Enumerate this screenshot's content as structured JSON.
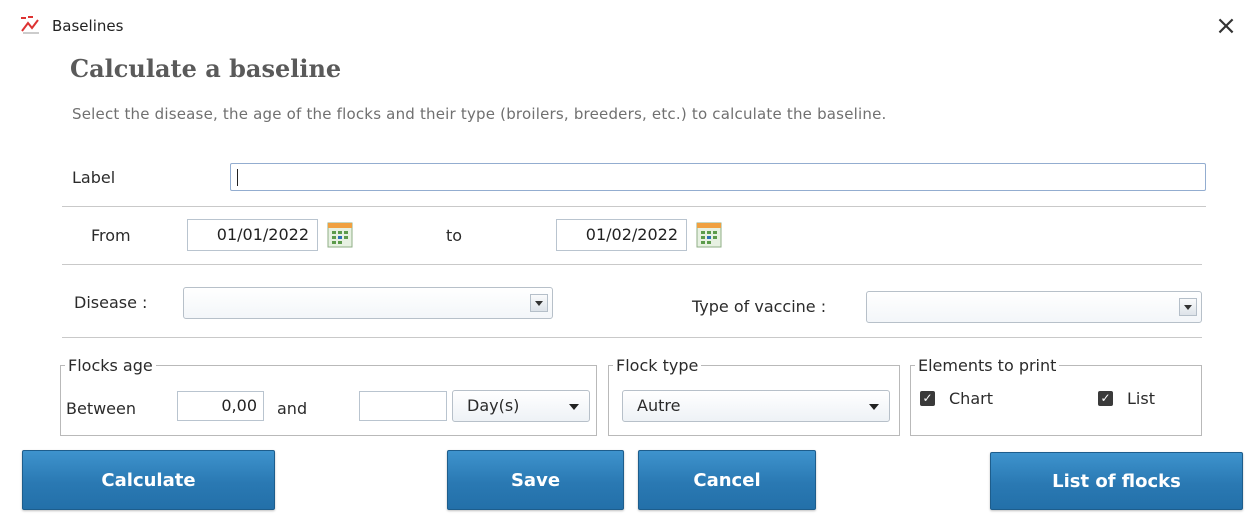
{
  "window": {
    "title": "Baselines",
    "close_glyph": "×",
    "icon": "baselines-app-icon"
  },
  "header": {
    "title": "Calculate a baseline",
    "description": "Select the disease, the age of the flocks and their type (broilers, breeders, etc.) to calculate the baseline."
  },
  "label_field": {
    "label": "Label",
    "value": ""
  },
  "date_range": {
    "from_label": "From",
    "from_value": "01/01/2022",
    "to_label": "to",
    "to_value": "01/02/2022",
    "icon": "calendar-icon"
  },
  "disease": {
    "label": "Disease :",
    "value": ""
  },
  "vaccine": {
    "label": "Type of vaccine :",
    "value": ""
  },
  "flocks_age": {
    "legend": "Flocks age",
    "between_label": "Between",
    "min_value": "0,00",
    "and_label": "and",
    "max_value": "",
    "unit_value": "Day(s)"
  },
  "flock_type": {
    "legend": "Flock type",
    "value": "Autre"
  },
  "print": {
    "legend": "Elements to print",
    "chart_label": "Chart",
    "chart_checked": true,
    "list_label": "List",
    "list_checked": true,
    "check_glyph": "✓"
  },
  "buttons": {
    "calculate": "Calculate",
    "save": "Save",
    "cancel": "Cancel",
    "list_of_flocks": "List of flocks"
  },
  "colors": {
    "button_blue": "#2a79b3",
    "heading_gray": "#5a5a5a"
  }
}
